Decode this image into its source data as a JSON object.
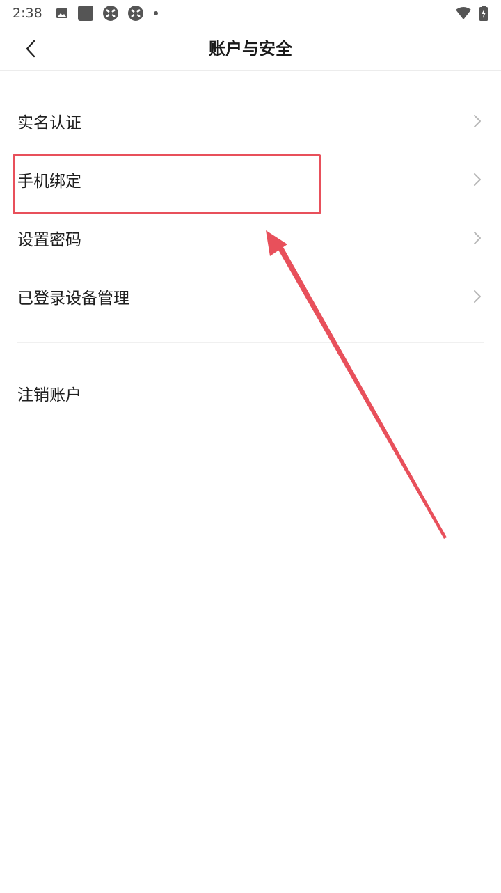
{
  "status_bar": {
    "time": "2:38",
    "left_icons": [
      "image-icon",
      "app-square-icon",
      "sync-icon",
      "sync-icon",
      "dot-icon"
    ],
    "right_icons": [
      "wifi-icon",
      "battery-charging-icon"
    ]
  },
  "header": {
    "title": "账户与安全",
    "back_icon": "chevron-left-icon"
  },
  "menu": {
    "items": [
      {
        "label": "实名认证"
      },
      {
        "label": "手机绑定"
      },
      {
        "label": "设置密码"
      },
      {
        "label": "已登录设备管理"
      }
    ],
    "cancel_label": "注销账户"
  },
  "annotation": {
    "color": "#e8505b"
  }
}
